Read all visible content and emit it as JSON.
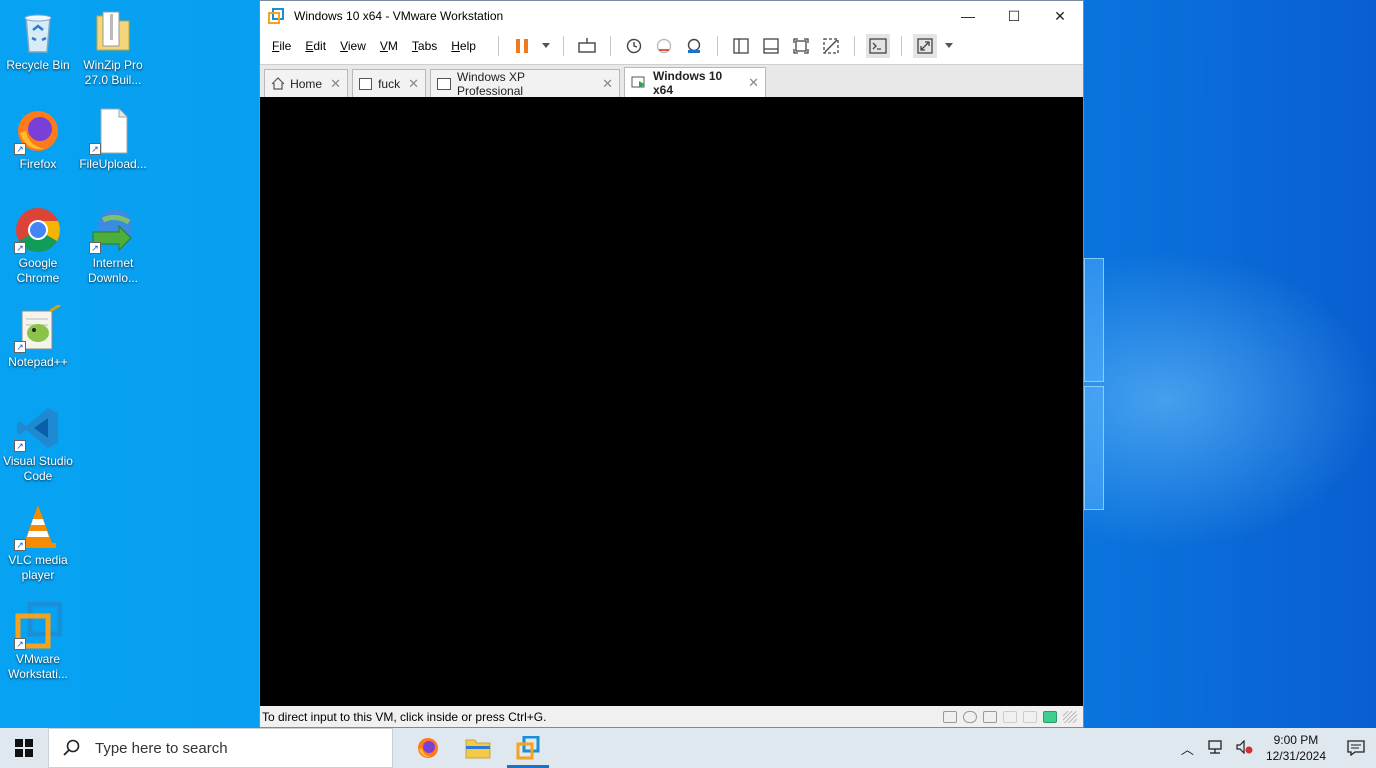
{
  "desktop": {
    "icons": [
      {
        "label": "Recycle Bin"
      },
      {
        "label": "WinZip Pro 27.0 Buil..."
      },
      {
        "label": "Firefox"
      },
      {
        "label": "FileUpload..."
      },
      {
        "label": "Google Chrome"
      },
      {
        "label": "Internet Downlo..."
      },
      {
        "label": "Notepad++"
      },
      {
        "label": "Visual Studio Code"
      },
      {
        "label": "VLC media player"
      },
      {
        "label": "VMware Workstati..."
      }
    ]
  },
  "window": {
    "title": "Windows 10 x64 - VMware Workstation",
    "controls": {
      "minimize": "—",
      "maximize": "☐",
      "close": "✕"
    }
  },
  "menu": {
    "items": [
      {
        "first": "F",
        "rest": "ile"
      },
      {
        "first": "E",
        "rest": "dit"
      },
      {
        "first": "V",
        "rest": "iew"
      },
      {
        "first": "V",
        "rest": "M"
      },
      {
        "first": "T",
        "rest": "abs"
      },
      {
        "first": "H",
        "rest": "elp"
      }
    ]
  },
  "tabs": [
    {
      "label": "Home",
      "close": "✕"
    },
    {
      "label": "fuck",
      "close": "✕"
    },
    {
      "label": "Windows XP Professional",
      "close": "✕"
    },
    {
      "label": "Windows 10 x64",
      "close": "✕"
    }
  ],
  "status": {
    "text": "To direct input to this VM, click inside or press Ctrl+G."
  },
  "taskbar": {
    "search_placeholder": "Type here to search",
    "clock_time": "9:00 PM",
    "clock_date": "12/31/2024"
  },
  "colors": {
    "accent": "#1a73c8",
    "pause": "#f07a1c",
    "vmware_blue": "#1a8fd8",
    "vmware_orange": "#f7a21b"
  }
}
